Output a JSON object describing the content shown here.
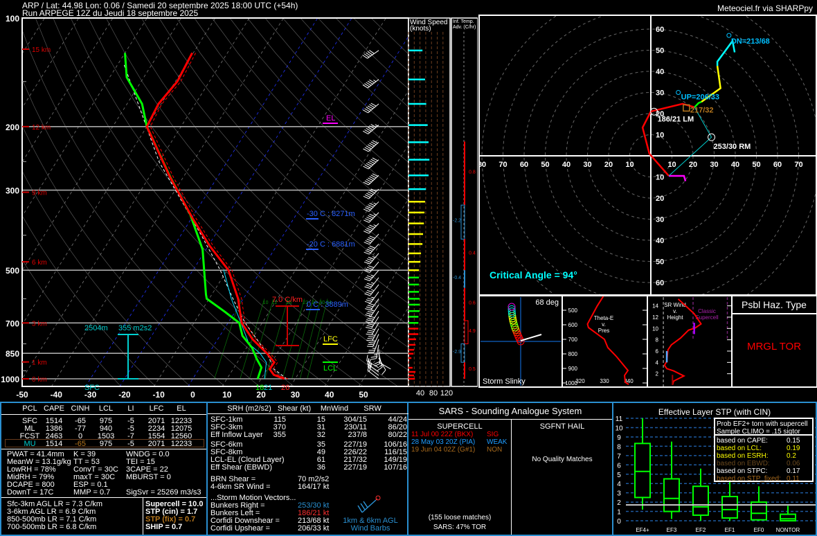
{
  "header": {
    "line1": "ARP / Lat: 44.98 Lon: 0.06 / Samedi 20 septembre 2025 18:00 UTC (+54h)",
    "line2": "Run ARPEGE 12Z du Jeudi 18 septembre 2025",
    "credit": "Meteociel.fr via SHARPpy"
  },
  "colors": {
    "temp": "#ff0000",
    "dewp": "#00ff00",
    "wetbulb": "#00ffff",
    "parcel": "#ffffff",
    "accent": "#2a8fd0",
    "orange": "#b8781e"
  },
  "chart_data": {
    "type": "skewt",
    "pressure_ticks": [
      "100",
      "200",
      "300",
      "500",
      "700",
      "850",
      "1000"
    ],
    "temp_ticks": [
      "-50",
      "-40",
      "-30",
      "-20",
      "-10",
      "0",
      "10",
      "20",
      "30",
      "40",
      "50"
    ],
    "temperature": [
      [
        125,
        -60.3
      ],
      [
        150,
        -59.4
      ],
      [
        173,
        -60.8
      ],
      [
        200,
        -60
      ],
      [
        275,
        -44.1
      ],
      [
        359,
        -29.7
      ],
      [
        428,
        -19.6
      ],
      [
        500,
        -9.6
      ],
      [
        600,
        -1.5
      ],
      [
        700,
        4
      ],
      [
        777,
        10.2
      ],
      [
        850,
        17
      ],
      [
        900,
        20.8
      ],
      [
        940,
        20.7
      ],
      [
        975,
        23
      ],
      [
        1000,
        26.8
      ]
    ],
    "dewpoint": [
      [
        125,
        -80
      ],
      [
        146,
        -75
      ],
      [
        173,
        -65.6
      ],
      [
        200,
        -60
      ],
      [
        275,
        -44
      ],
      [
        351,
        -31
      ],
      [
        438,
        -21
      ],
      [
        584,
        -11.7
      ],
      [
        600,
        -10.7
      ],
      [
        652,
        -3
      ],
      [
        700,
        3.3
      ],
      [
        760,
        6.6
      ],
      [
        820,
        11.6
      ],
      [
        880,
        15
      ],
      [
        930,
        18
      ],
      [
        1000,
        19
      ]
    ],
    "parcel": [
      [
        135,
        -78
      ],
      [
        250,
        -50
      ],
      [
        400,
        -24
      ],
      [
        500,
        -12
      ],
      [
        600,
        -3
      ],
      [
        700,
        5
      ],
      [
        850,
        17
      ],
      [
        940,
        22
      ],
      [
        1000,
        27.5
      ]
    ],
    "wetbulb": [
      [
        500,
        -11
      ],
      [
        600,
        -3.5
      ],
      [
        700,
        3.8
      ],
      [
        800,
        10
      ],
      [
        850,
        15
      ],
      [
        900,
        18.5
      ],
      [
        1000,
        21
      ]
    ],
    "height_labels": [
      {
        "p": 122,
        "t": "15 km"
      },
      {
        "p": 200,
        "t": "12 km"
      },
      {
        "p": 304,
        "t": "9 km"
      },
      {
        "p": 474,
        "t": "6 km"
      },
      {
        "p": 700,
        "t": "3 km"
      },
      {
        "p": 898,
        "t": "1 km"
      },
      {
        "p": 1000,
        "t": "0 km"
      }
    ],
    "annotations": {
      "el": "EL",
      "lfc": "LFC",
      "lcl": "LCL",
      "m30": "-30 C : 8271m",
      "m20": "-20 C : 6881m",
      "zero": "0 C : 3889m",
      "lapse": "7.0 C/km",
      "eff_depth": "2504m",
      "eff_srh": "355 m2s2",
      "sfc": "SFC",
      "sfc_td": "18",
      "sfc_tw": "21",
      "sfc_t": "26"
    },
    "mixing_ratio_labels": [
      "6",
      "10",
      "12",
      "16",
      "22",
      "26",
      "30",
      "34"
    ],
    "winds": [
      [
        123,
        235,
        48
      ],
      [
        148,
        232,
        57
      ],
      [
        173,
        230,
        61
      ],
      [
        198,
        230,
        66
      ],
      [
        221,
        228,
        69
      ],
      [
        247,
        228,
        72
      ],
      [
        273,
        227,
        69
      ],
      [
        298,
        226,
        60
      ],
      [
        323,
        225,
        57
      ],
      [
        346,
        224,
        55
      ],
      [
        371,
        224,
        53
      ],
      [
        397,
        222,
        50
      ],
      [
        423,
        222,
        48
      ],
      [
        449,
        220,
        43
      ],
      [
        474,
        220,
        41
      ],
      [
        500,
        220,
        36
      ],
      [
        524,
        218,
        36
      ],
      [
        548,
        218,
        36
      ],
      [
        574,
        216,
        36
      ],
      [
        600,
        215,
        38
      ],
      [
        623,
        214,
        38
      ],
      [
        649,
        212,
        38
      ],
      [
        673,
        212,
        34
      ],
      [
        700,
        210,
        34
      ],
      [
        726,
        208,
        34
      ],
      [
        752,
        205,
        34
      ],
      [
        777,
        200,
        26
      ],
      [
        805,
        190,
        24
      ],
      [
        831,
        175,
        19
      ],
      [
        852,
        165,
        17
      ],
      [
        876,
        150,
        10
      ],
      [
        899,
        120,
        2
      ],
      [
        932,
        300,
        14
      ],
      [
        957,
        305,
        24
      ],
      [
        979,
        308,
        19
      ],
      [
        1000,
        307,
        22
      ]
    ],
    "wind_speed_ticks": [
      "40",
      "80",
      "120"
    ],
    "wind_speed_title": "Wind Speed (knots)",
    "temp_adv_title": "Inf. Temp. Adv. (C/hr)",
    "temp_adv": [
      {
        "top": 220,
        "bot": 330,
        "v": "0.8"
      },
      {
        "top": 330,
        "bot": 410,
        "v": "-2.2"
      },
      {
        "top": 410,
        "bot": 500,
        "v": "0.4"
      },
      {
        "top": 500,
        "bot": 560,
        "v": "-0.4"
      },
      {
        "top": 560,
        "bot": 690,
        "v": "0.6"
      },
      {
        "top": 690,
        "bot": 800,
        "v": "4.9"
      },
      {
        "top": 800,
        "bot": 900,
        "v": "-2.9"
      },
      {
        "top": 900,
        "bot": 1000,
        "v": "0.5"
      }
    ]
  },
  "hodograph": {
    "ring_labels": [
      "10",
      "20",
      "30",
      "40",
      "50",
      "60",
      "70",
      "80"
    ],
    "trace": [
      [
        16.4,
        -12
      ],
      [
        15.7,
        -9.5
      ],
      [
        8.5,
        -9.5
      ],
      [
        -0.7,
        1
      ],
      [
        -3.9,
        13.4
      ],
      [
        0,
        21
      ],
      [
        15,
        24.6
      ],
      [
        20.7,
        23
      ],
      [
        22.6,
        25
      ],
      [
        24,
        25.6
      ],
      [
        26,
        27
      ],
      [
        33,
        32
      ],
      [
        31.5,
        42.6
      ],
      [
        31.5,
        44.6
      ],
      [
        38.7,
        54.4
      ],
      [
        39.7,
        49
      ]
    ],
    "rm": {
      "u": 28.7,
      "v": 8.8,
      "label": "253/30 RM"
    },
    "lm": {
      "u": 1.5,
      "v": 20.9,
      "label": "186/21 LM"
    },
    "up": {
      "u": 13,
      "v": 30,
      "label": "UP=206/33"
    },
    "dn": {
      "u": 37,
      "v": 57,
      "label": "DN=213/68"
    },
    "mean": {
      "u": 17,
      "v": 22.5,
      "label": "217/32"
    },
    "critical_angle": "Critical Angle = 94°"
  },
  "slinky": {
    "title": "Storm Slinky",
    "angle": "68 deg"
  },
  "thetae": {
    "title": [
      "Theta-E",
      "v.",
      "Pres"
    ],
    "yticks": [
      "500",
      "600",
      "700",
      "800",
      "900",
      "1000"
    ],
    "xticks": [
      "320",
      "330",
      "340"
    ],
    "profile": [
      [
        405,
        329.5
      ],
      [
        471,
        327
      ],
      [
        595,
        323
      ],
      [
        619,
        323.4
      ],
      [
        700,
        330
      ],
      [
        757,
        331.4
      ],
      [
        819,
        335
      ],
      [
        914,
        339.7
      ],
      [
        948,
        338.3
      ],
      [
        995,
        338.6
      ],
      [
        1010,
        340
      ]
    ]
  },
  "srwind": {
    "title": [
      "SR Wind",
      "v.",
      "Height"
    ],
    "yticks": [
      "2",
      "4",
      "6",
      "8",
      "10",
      "12",
      "14"
    ],
    "classic": [
      "Classic",
      "Supercell"
    ],
    "profile": [
      [
        15.2,
        27
      ],
      [
        12.6,
        41
      ],
      [
        10.8,
        47
      ],
      [
        10.1,
        42
      ],
      [
        9.7,
        36
      ],
      [
        8.3,
        29
      ],
      [
        7.1,
        21
      ],
      [
        6.2,
        18
      ],
      [
        4.2,
        17
      ],
      [
        3.5,
        15
      ],
      [
        2.9,
        17
      ],
      [
        2.5,
        23
      ],
      [
        1.6,
        32
      ],
      [
        0.7,
        23
      ],
      [
        0,
        22
      ]
    ]
  },
  "hazard": {
    "title": "Psbl Haz. Type",
    "value": "MRGL TOR"
  },
  "parcels": {
    "headers": [
      "PCL",
      "CAPE",
      "CINH",
      "LCL",
      "LI",
      "LFC",
      "EL"
    ],
    "rows": [
      [
        "SFC",
        "1514",
        "-65",
        "975",
        "-5",
        "2071",
        "12233"
      ],
      [
        "ML",
        "1386",
        "-77",
        "940",
        "-5",
        "2234",
        "12075"
      ],
      [
        "FCST",
        "2463",
        "0",
        "1503",
        "-7",
        "1554",
        "12560"
      ],
      [
        "MU",
        "1514",
        "-65",
        "975",
        "-5",
        "2071",
        "12233"
      ]
    ]
  },
  "indices": {
    "col1": [
      "PWAT = 41.4mm",
      "MeanW = 13.1g/kg",
      "LowRH = 78%",
      "MidRH = 79%",
      "DCAPE = 800",
      "DownT = 17C"
    ],
    "col2": [
      "K = 39",
      "TT = 53",
      "ConvT = 30C",
      "maxT = 30C",
      "ESP = 0.1",
      "MMP = 0.7"
    ],
    "col3": [
      "WNDG = 0.0",
      "TEI = 15",
      "3CAPE = 22",
      "MBURST = 0",
      "",
      "SigSvr = 25269 m3/s3"
    ]
  },
  "lapse": [
    "Sfc-3km AGL LR = 7.3 C/km",
    "3-6km AGL LR = 6.9 C/km",
    "850-500mb LR = 7.1 C/km",
    "700-500mb LR = 6.8 C/km"
  ],
  "composite": [
    "Supercell = 10.0",
    "STP (cin) = 1.7",
    "STP (fix) = 0.7",
    "SHIP = 0.7"
  ],
  "kinematics": {
    "headers": [
      "SRH (m2/s2)",
      "Shear (kt)",
      "MnWind",
      "SRW"
    ],
    "rows1": [
      [
        "SFC-1km",
        "115",
        "15",
        "304/15",
        "44/24"
      ],
      [
        "SFC-3km",
        "370",
        "31",
        "230/11",
        "86/20"
      ],
      [
        "Eff Inflow Layer",
        "355",
        "32",
        "237/8",
        "80/22"
      ]
    ],
    "rows2": [
      [
        "SFC-6km",
        "",
        "35",
        "227/19",
        "106/16"
      ],
      [
        "SFC-8km",
        "",
        "49",
        "226/22",
        "116/15"
      ],
      [
        "LCL-EL (Cloud Layer)",
        "",
        "61",
        "217/32",
        "149/19"
      ],
      [
        "Eff Shear (EBWD)",
        "",
        "36",
        "227/19",
        "107/16"
      ]
    ],
    "brn": [
      "BRN Shear =",
      "70 m2/s2"
    ],
    "sr46": [
      "4-6km SR Wind =",
      "164/17 kt"
    ],
    "smv_title": "...Storm Motion Vectors...",
    "smv": [
      [
        "Bunkers Right =",
        "253/30 kt"
      ],
      [
        "Bunkers Left =",
        "186/21 kt"
      ],
      [
        "Corfidi Downshear =",
        "213/68 kt"
      ],
      [
        "Corfidi Upshear =",
        "206/33 kt"
      ]
    ],
    "barb_label": [
      "1km & 6km AGL",
      "Wind Barbs"
    ]
  },
  "sars": {
    "title": "SARS - Sounding Analogue System",
    "supercell_title": "SUPERCELL",
    "hail_title": "SGFNT HAIL",
    "matches": [
      {
        "date": "11 Jul 00 22Z (BKX)",
        "cls": "SIG",
        "color": "#ff0000"
      },
      {
        "date": "28 May 03 20Z (PIA)",
        "cls": "WEAK",
        "color": "#1e9cff"
      },
      {
        "date": "19 Jun 04 02Z (G#1)",
        "cls": "NON",
        "color": "#a86a1c"
      }
    ],
    "loose": "(155 loose matches)",
    "tor": "SARS: 47% TOR",
    "hail": "No Quality Matches"
  },
  "stp": {
    "title": "Effective Layer STP (with CIN)",
    "yticks": [
      "0",
      "1",
      "2",
      "3",
      "4",
      "5",
      "6",
      "7",
      "8",
      "9",
      "10",
      "11"
    ],
    "current": 1.7,
    "boxes": [
      {
        "name": "EF4+",
        "lo": 1.2,
        "q1": 2.5,
        "med": 5.3,
        "q3": 8.3,
        "hi": 11
      },
      {
        "name": "EF3",
        "lo": 0.2,
        "q1": 1,
        "med": 2.4,
        "q3": 4.5,
        "hi": 8.5
      },
      {
        "name": "EF2",
        "lo": 0,
        "q1": 0.6,
        "med": 1.5,
        "q3": 3.7,
        "hi": 5.6
      },
      {
        "name": "EF1",
        "lo": 0,
        "q1": 0.3,
        "med": 1.2,
        "q3": 2.6,
        "hi": 4.5
      },
      {
        "name": "EF0",
        "lo": 0,
        "q1": 0.1,
        "med": 0.8,
        "q3": 2,
        "hi": 3.7
      },
      {
        "name": "NONTOR",
        "lo": 0,
        "q1": 0,
        "med": 0.2,
        "q3": 0.7,
        "hi": 1.6
      }
    ],
    "prob_title": [
      "Prob EF2+ torn with supercell",
      "Sample CLIMO = .15 sigtor"
    ],
    "prob": [
      {
        "k": "based on CAPE:",
        "v": "0.15",
        "color": "#ffffff"
      },
      {
        "k": "based on LCL:",
        "v": "0.19",
        "color": "#ffff00"
      },
      {
        "k": "based on ESRH:",
        "v": "0.2",
        "color": "#ffff00"
      },
      {
        "k": "based on EBWD:",
        "v": "0.06",
        "color": "#6b4a1e"
      },
      {
        "k": "based on STPC:",
        "v": "0.17",
        "color": "#ffffff"
      },
      {
        "k": "based on STP_fixed:",
        "v": "0.11",
        "color": "#a86a1c"
      }
    ]
  }
}
